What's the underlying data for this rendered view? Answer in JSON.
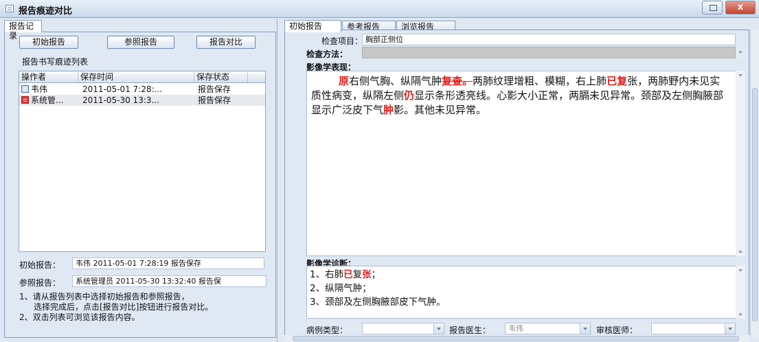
{
  "window": {
    "title": "报告痕迹对比",
    "close_label": "x"
  },
  "left": {
    "tab_label": "报告记录",
    "buttons": {
      "initial": "初始报告",
      "reference": "参照报告",
      "compare": "报告对比"
    },
    "list_title": "报告书写痕迹列表",
    "columns": [
      "操作者",
      "保存时间",
      "保存状态"
    ],
    "rows": [
      {
        "operator": "韦伟",
        "time": "2011-05-01 7:28:...",
        "status": "报告保存",
        "icon": "doc-blue-icon"
      },
      {
        "operator": "系统管...",
        "time": "2011-05-30 13:3...",
        "status": "报告保存",
        "icon": "doc-red-icon"
      }
    ],
    "initial_label": "初始报告：",
    "initial_value": "韦伟 2011-05-01 7:28:19 报告保存",
    "reference_label": "参照报告：",
    "reference_value": "系统管理员 2011-05-30 13:32:40 报告保",
    "instructions": [
      "1、请从报告列表中选择初始报告和参照报告，",
      "选择完成后，点击[报告对比]按钮进行报告对比。",
      "2、双击列表可浏览该报告内容。"
    ]
  },
  "right": {
    "tabs": [
      "初始报告",
      "参考报告",
      "浏览报告"
    ],
    "exam_item_label": "检查项目：",
    "exam_item_value": "胸部正侧位",
    "exam_method_label": "检查方法：",
    "findings_label": "影像学表现：",
    "findings": {
      "p1": "原",
      "p2": "右侧气胸、纵隔气肿",
      "p3": "复查。",
      "p4": "两肺纹理增粗、模糊，右上肺",
      "p5": "已复",
      "p6": "张，两肺野内未见实质性病变，纵隔左侧",
      "p7": "仍",
      "p8": "显示条形透亮线。心影大小正常，两膈未见异常。颈部及左侧胸腋部显示广泛皮下气",
      "p9": "肿",
      "p10": "影。其他未见异常。"
    },
    "diagnosis_label": "影像学诊断：",
    "diagnosis": {
      "l1a": "1、右肺",
      "l1b": "已",
      "l1c": "复",
      "l1d": "张",
      "l1e": "；",
      "l2": "2、纵隔气肿；",
      "l3": "3、颈部及左侧胸腋部皮下气肿。"
    },
    "case_type_label": "病例类型：",
    "case_type_value": "",
    "doctor_label": "报告医生：",
    "doctor_value": "韦伟",
    "reviewer_label": "审核医师：",
    "reviewer_value": ""
  },
  "colors": {
    "accent_red": "#e31b1b",
    "frame_blue": "#7f9bbd",
    "panel_bg": "#dfe8f3"
  }
}
